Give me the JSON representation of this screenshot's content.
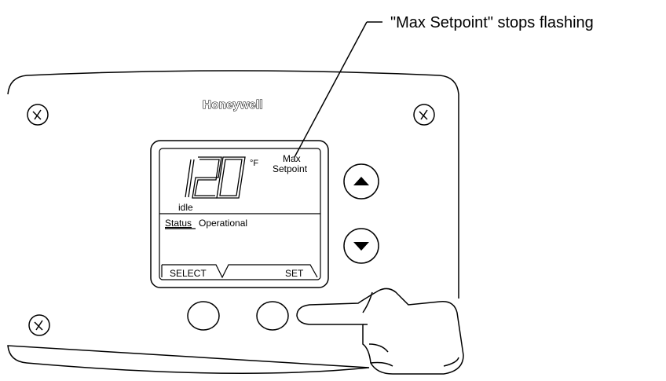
{
  "callout": {
    "text": "\"Max Setpoint\" stops flashing"
  },
  "device": {
    "brand": "Honeywell",
    "display": {
      "temperature": "120",
      "unit": "°F",
      "indicator_line1": "Max",
      "indicator_line2": "Setpoint",
      "mode": "idle",
      "status_label": "Status",
      "status_value": "Operational",
      "softkey_left": "SELECT",
      "softkey_right": "SET"
    },
    "buttons": [
      "up-arrow",
      "down-arrow",
      "left-softkey-button",
      "right-softkey-button"
    ],
    "pointer": "pointing-hand"
  }
}
